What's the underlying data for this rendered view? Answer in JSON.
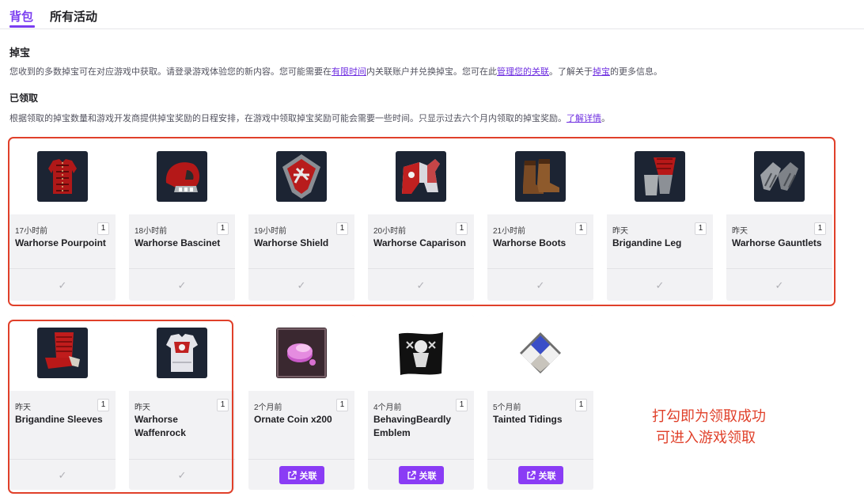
{
  "tabs": {
    "backpack": "背包",
    "all_activity": "所有活动"
  },
  "drops": {
    "title": "掉宝",
    "desc": {
      "part1": "您收到的多数掉宝可在对应游戏中获取。请登录游戏体验您的新内容。您可能需要在",
      "link1": "有限时间",
      "part2": "内关联账户并兑换掉宝。您可在此",
      "link2": "管理您的关联",
      "part3": "。了解关于",
      "link3": "掉宝",
      "part4": "的更多信息。"
    }
  },
  "claimed": {
    "title": "已领取",
    "desc": {
      "part1": "根据领取的掉宝数量和游戏开发商提供掉宝奖励的日程安排，在游戏中领取掉宝奖励可能会需要一些时间。只显示过去六个月内领取的掉宝奖励。",
      "link": "了解详情",
      "part2": "。"
    }
  },
  "link_label": "关联",
  "items": [
    {
      "time": "17小时前",
      "qty": "1",
      "name": "Warhorse Pourpoint",
      "status": "claimed",
      "icon": "pourpoint-icon"
    },
    {
      "time": "18小时前",
      "qty": "1",
      "name": "Warhorse Bascinet",
      "status": "claimed",
      "icon": "bascinet-icon"
    },
    {
      "time": "19小时前",
      "qty": "1",
      "name": "Warhorse Shield",
      "status": "claimed",
      "icon": "shield-icon"
    },
    {
      "time": "20小时前",
      "qty": "1",
      "name": "Warhorse Caparison",
      "status": "claimed",
      "icon": "caparison-icon"
    },
    {
      "time": "21小时前",
      "qty": "1",
      "name": "Warhorse Boots",
      "status": "claimed",
      "icon": "boots-icon"
    },
    {
      "time": "昨天",
      "qty": "1",
      "name": "Brigandine Leg",
      "status": "claimed",
      "icon": "leg-armor-icon"
    },
    {
      "time": "昨天",
      "qty": "1",
      "name": "Warhorse Gauntlets",
      "status": "claimed",
      "icon": "gauntlets-icon"
    },
    {
      "time": "昨天",
      "qty": "1",
      "name": "Brigandine Sleeves",
      "status": "claimed",
      "icon": "sleeves-icon"
    },
    {
      "time": "昨天",
      "qty": "1",
      "name": "Warhorse Waffenrock",
      "status": "claimed",
      "icon": "waffenrock-icon"
    },
    {
      "time": "2个月前",
      "qty": "1",
      "name": "Ornate Coin x200",
      "status": "link",
      "icon": "coin-icon"
    },
    {
      "time": "4个月前",
      "qty": "1",
      "name": "BehavingBeardly Emblem",
      "status": "link",
      "icon": "emblem-flag-icon"
    },
    {
      "time": "5个月前",
      "qty": "1",
      "name": "Tainted Tidings",
      "status": "link",
      "icon": "tidings-icon"
    }
  ],
  "annotation": {
    "line1": "打勾即为领取成功",
    "line2": "可进入游戏领取"
  },
  "colors": {
    "accent": "#8a3cf5",
    "annotation": "#e0402a"
  }
}
